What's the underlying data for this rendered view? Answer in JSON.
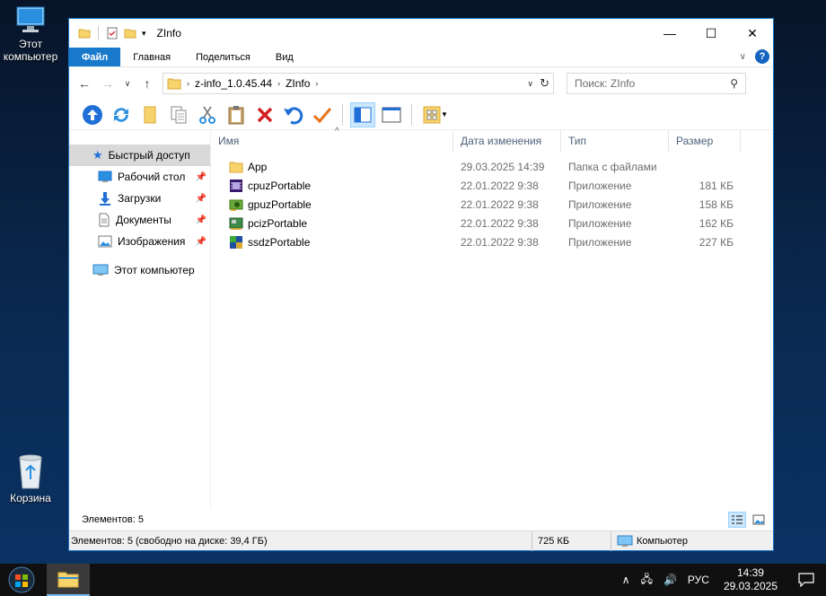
{
  "desktop": {
    "this_pc_label": "Этот компьютер",
    "recycle_label": "Корзина"
  },
  "window": {
    "title": "ZInfo",
    "ribbon_tabs": [
      "Файл",
      "Главная",
      "Поделиться",
      "Вид"
    ],
    "address": {
      "crumbs": [
        "z-info_1.0.45.44",
        "ZInfo"
      ]
    },
    "search": {
      "placeholder": "Поиск: ZInfo"
    },
    "nav": {
      "quick_access": "Быстрый доступ",
      "items": [
        {
          "label": "Рабочий стол",
          "icon": "desktop-icon"
        },
        {
          "label": "Загрузки",
          "icon": "downloads-icon"
        },
        {
          "label": "Документы",
          "icon": "documents-icon"
        },
        {
          "label": "Изображения",
          "icon": "pictures-icon"
        }
      ],
      "this_pc": "Этот компьютер"
    },
    "columns": {
      "name": "Имя",
      "date": "Дата изменения",
      "type": "Тип",
      "size": "Размер"
    },
    "files": [
      {
        "name": "App",
        "date": "29.03.2025 14:39",
        "type": "Папка с файлами",
        "size": "",
        "icon": "folder-icon"
      },
      {
        "name": "cpuzPortable",
        "date": "22.01.2022 9:38",
        "type": "Приложение",
        "size": "181 КБ",
        "icon": "cpuz-icon"
      },
      {
        "name": "gpuzPortable",
        "date": "22.01.2022 9:38",
        "type": "Приложение",
        "size": "158 КБ",
        "icon": "gpuz-icon"
      },
      {
        "name": "pcizPortable",
        "date": "22.01.2022 9:38",
        "type": "Приложение",
        "size": "162 КБ",
        "icon": "pciz-icon"
      },
      {
        "name": "ssdzPortable",
        "date": "22.01.2022 9:38",
        "type": "Приложение",
        "size": "227 КБ",
        "icon": "ssdz-icon"
      }
    ],
    "items_count": "Элементов: 5",
    "status": {
      "left": "Элементов: 5 (свободно на диске: 39,4 ГБ)",
      "size": "725 КБ",
      "location": "Компьютер"
    }
  },
  "taskbar": {
    "lang": "РУС",
    "time": "14:39",
    "date": "29.03.2025"
  },
  "colors": {
    "accent": "#1979ca",
    "selection": "#cce8ff",
    "taskbar": "#101010"
  }
}
